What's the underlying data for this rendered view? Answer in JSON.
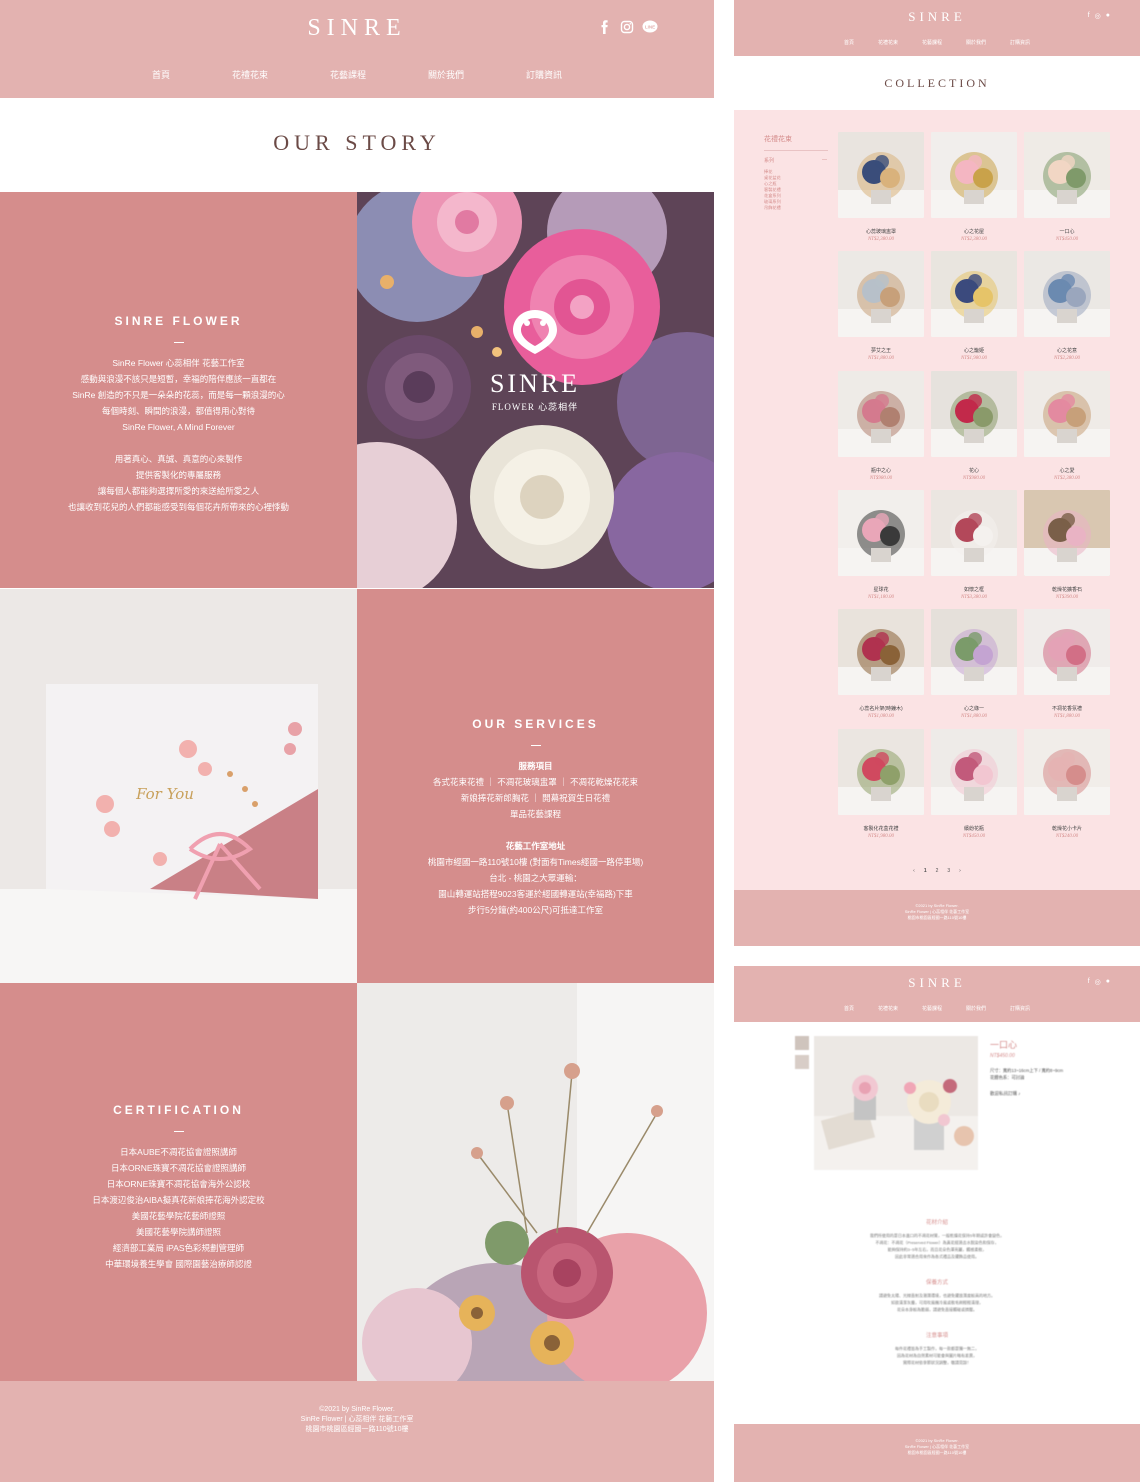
{
  "story_page": {
    "logo": "SINRE",
    "social": [
      "facebook-icon",
      "instagram-icon",
      "line-icon"
    ],
    "nav": [
      "首頁",
      "花禮花束",
      "花藝課程",
      "關於我們",
      "訂購資訊"
    ],
    "title": "OUR STORY",
    "flower_section": {
      "heading": "SINRE FLOWER",
      "lines": [
        "SinRe Flower 心蕊相伴 花藝工作室",
        "感動與浪漫不該只是短暫，幸福的陪伴應該一直都在",
        "SinRe 創造的不只是一朵朵的花蕊，而是每一顆浪漫的心",
        "每個時刻、瞬間的浪漫，都值得用心對待",
        "SinRe Flower, A Mind Forever",
        "",
        "用著真心、真誠、真意的心來製作",
        "提供客製化的專屬服務",
        "讓每個人都能夠選擇所愛的來送給所愛之人",
        "也讓收到花兒的人們都能感受到每個花卉所帶來的心裡悸動"
      ]
    },
    "photo_logo": {
      "brand": "SINRE",
      "sub": "FLOWER 心蕊相伴"
    },
    "card_text": "For You",
    "services_section": {
      "heading": "OUR SERVICES",
      "lines": [
        "服務項目",
        "各式花束花禮 ｜ 不凋花玻璃盅罩 ｜ 不凋花乾燥花花束",
        "新娘捧花新郎胸花 ｜ 開幕祝賀生日花禮",
        "單品花藝課程",
        "",
        "花藝工作室地址",
        "桃園市經國一路110號10樓 (對面有Times經國一路停車場)",
        "台北 - 桃園之大眾運輸：",
        "園山轉運站搭程9023客運於經國轉運站(幸福路)下車",
        "步行5分鐘(約400公尺)可抵達工作室"
      ]
    },
    "cert_section": {
      "heading": "CERTIFICATION",
      "lines": [
        "日本AUBE不凋花協會證照講師",
        "日本ORNE珠寶不凋花協會證照講師",
        "日本ORNE珠寶不凋花協會海外公認校",
        "日本渡辺俊治AIBA擬真花新娘捧花海外認定校",
        "美國花藝學院花藝師證照",
        "美國花藝學院講師證照",
        "經濟部工業局 iPAS色彩規劃管理師",
        "中華環境養生學會 國際園藝治療師認證"
      ]
    },
    "footer": [
      "©2021 by SinRe Flower.",
      "SinRe Flower | 心蕊相伴 花藝工作室",
      "桃園市桃園區經國一路110號10樓"
    ]
  },
  "collection_page": {
    "logo": "SINRE",
    "nav": [
      "首頁",
      "花禮花束",
      "花藝課程",
      "關於我們",
      "訂購資訊"
    ],
    "title": "COLLECTION",
    "sidebar": {
      "category": "花禮花束",
      "group": "系列",
      "toggle": "—",
      "items": [
        "捧花",
        "桌花盆花",
        "心之瓶",
        "客製花禮",
        "花盒系列",
        "玻璃系列",
        "吊飾花禮"
      ]
    },
    "products": [
      {
        "name": "心蕊玻璃盅罩",
        "price": "NT$2,380.00",
        "palette": [
          "#e9e4df",
          "#3a4d7a",
          "#d9b27c"
        ]
      },
      {
        "name": "心之花屋",
        "price": "NT$2,380.00",
        "palette": [
          "#f1eeec",
          "#f4b6c2",
          "#c9a24a"
        ]
      },
      {
        "name": "一口心",
        "price": "NT$450.00",
        "palette": [
          "#efebe6",
          "#f1d6c4",
          "#7f9a6a"
        ]
      },
      {
        "name": "夢艾之王",
        "price": "NT$1,880.00",
        "palette": [
          "#ece9e5",
          "#b7c0c9",
          "#c7a07a"
        ]
      },
      {
        "name": "心之籠姫",
        "price": "NT$1,980.00",
        "palette": [
          "#e9e5df",
          "#3b4a7d",
          "#e6c469"
        ]
      },
      {
        "name": "心之花意",
        "price": "NT$2,280.00",
        "palette": [
          "#ebe8e4",
          "#6b8ab0",
          "#9aa6bd"
        ]
      },
      {
        "name": "瓶中之心",
        "price": "NT$980.00",
        "palette": [
          "#eeebe7",
          "#d47a8e",
          "#b08070"
        ]
      },
      {
        "name": "花心",
        "price": "NT$980.00",
        "palette": [
          "#e6e2dd",
          "#c2294a",
          "#8a9a6a"
        ]
      },
      {
        "name": "心之愛",
        "price": "NT$2,380.00",
        "palette": [
          "#efebe7",
          "#e38aa0",
          "#c7a07a"
        ]
      },
      {
        "name": "星球花",
        "price": "NT$1,180.00",
        "palette": [
          "#f2efec",
          "#e9a6b8",
          "#3a3a3a"
        ]
      },
      {
        "name": "如懷之框",
        "price": "NT$3,380.00",
        "palette": [
          "#ebe6e1",
          "#b3485a",
          "#f4f1ee"
        ]
      },
      {
        "name": "乾燥花擴香石",
        "price": "NT$390.00",
        "palette": [
          "#d9c7b1",
          "#7a5f49",
          "#e9b3c4"
        ]
      },
      {
        "name": "心蕊名片架(時鐘木)",
        "price": "NT$1,080.00",
        "palette": [
          "#e9e3dc",
          "#b0324f",
          "#8a6238"
        ]
      },
      {
        "name": "心之綠一",
        "price": "NT$1,880.00",
        "palette": [
          "#e5e0da",
          "#7b9b6a",
          "#c4a4d2"
        ]
      },
      {
        "name": "不凋花香氛禮",
        "price": "NT$1,880.00",
        "palette": [
          "#f0ecea",
          "#e4a2b6",
          "#d26f86"
        ]
      },
      {
        "name": "客製化花盒花禮",
        "price": "NT$1,980.00",
        "palette": [
          "#ebe6e1",
          "#d0495f",
          "#8fa06a"
        ]
      },
      {
        "name": "繽紛花瓶",
        "price": "NT$450.00",
        "palette": [
          "#eeebe8",
          "#c25a7b",
          "#f2c6d1"
        ]
      },
      {
        "name": "乾燥花小卡片",
        "price": "NT$240.00",
        "palette": [
          "#f1ede9",
          "#e5b3b3",
          "#d58d8c"
        ]
      }
    ],
    "pagination": [
      "‹",
      "1",
      "2",
      "3",
      "›"
    ],
    "footer": [
      "©2021 by SinRe Flower.",
      "SinRe Flower | 心蕊相伴 花藝工作室",
      "桃園市桃園區經國一路110號10樓"
    ]
  },
  "detail_page": {
    "logo": "SINRE",
    "nav": [
      "首頁",
      "花禮花束",
      "花藝課程",
      "關於我們",
      "訂購資訊"
    ],
    "product_name": "一口心",
    "price": "NT$450.00",
    "specs": [
      "尺寸：寬約13~16cm上下 / 寬約8~9cm",
      "花體色系：可討論"
    ],
    "order_note": "歡迎私訊訂購 ♪",
    "sections": [
      {
        "title": "花材介紹",
        "lines": [
          "我們所使用的是日本進口的不凋花材質，一般乾燥花保持5年期或許會變色，",
          "不凋花：不凋花（Preserved Flower）為真花經過去水脫染色和保存，",
          "能夠保持約3~5年左右，而且花朵色澤亮麗，觸感柔軟，",
          "因此非常適合用來作為各式禮品及擺飾品使用。"
        ]
      },
      {
        "title": "保養方式",
        "lines": [
          "請避免太陽、光線直射及潮濕環境，也避免擺放濕度較高的地方。",
          "如欲清潔灰塵，可用吹風機冷風或軟毛刷輕輕清理，",
          "花朵本身較為脆弱，請避免直接觸碰或擠壓。"
        ]
      },
      {
        "title": "注意事項",
        "lines": [
          "每件花禮皆為手工製作，每一款都是獨一無二，",
          "因為花材為自然素材可能會與圖片略有差異，",
          "實際花材依季節狀況調整，敬請見諒！"
        ]
      }
    ],
    "footer": [
      "©2021 by SinRe Flower.",
      "SinRe Flower | 心蕊相伴 花藝工作室",
      "桃園市桃園區經國一路110號10樓"
    ]
  }
}
